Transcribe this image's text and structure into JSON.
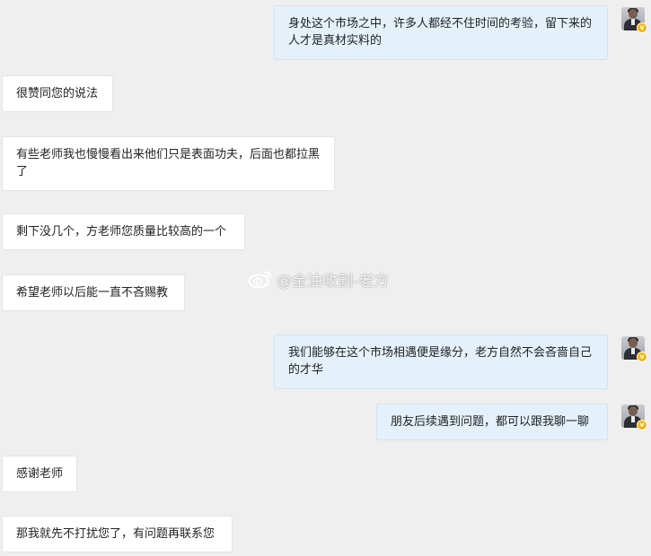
{
  "messages": [
    {
      "side": "out",
      "text": "身处这个市场之中，许多人都经不住时间的考验，留下来的人才是真材实料的"
    },
    {
      "side": "in",
      "text": "很赞同您的说法"
    },
    {
      "side": "in",
      "text": "有些老师我也慢慢看出来他们只是表面功夫，后面也都拉黑了"
    },
    {
      "side": "in",
      "text": "剩下没几个，方老师您质量比较高的一个"
    },
    {
      "side": "in",
      "text": "希望老师以后能一直不吝赐教"
    },
    {
      "side": "out",
      "text": "我们能够在这个市场相遇便是缘分，老方自然不会吝啬自己的才华"
    },
    {
      "side": "out",
      "text": "朋友后续遇到问题，都可以跟我聊一聊"
    },
    {
      "side": "in",
      "text": "感谢老师"
    },
    {
      "side": "in",
      "text": "那我就先不打扰您了，有问题再联系您"
    }
  ],
  "avatar": {
    "badge_icon": "verified-v-icon",
    "badge_glyph": "v",
    "badge_color": "#f7b500"
  },
  "watermark": {
    "icon": "weibo-logo-icon",
    "text": "@金油收割-老方"
  },
  "colors": {
    "background": "#efefef",
    "incoming_bubble": "#ffffff",
    "outgoing_bubble": "#e4f1fb"
  }
}
